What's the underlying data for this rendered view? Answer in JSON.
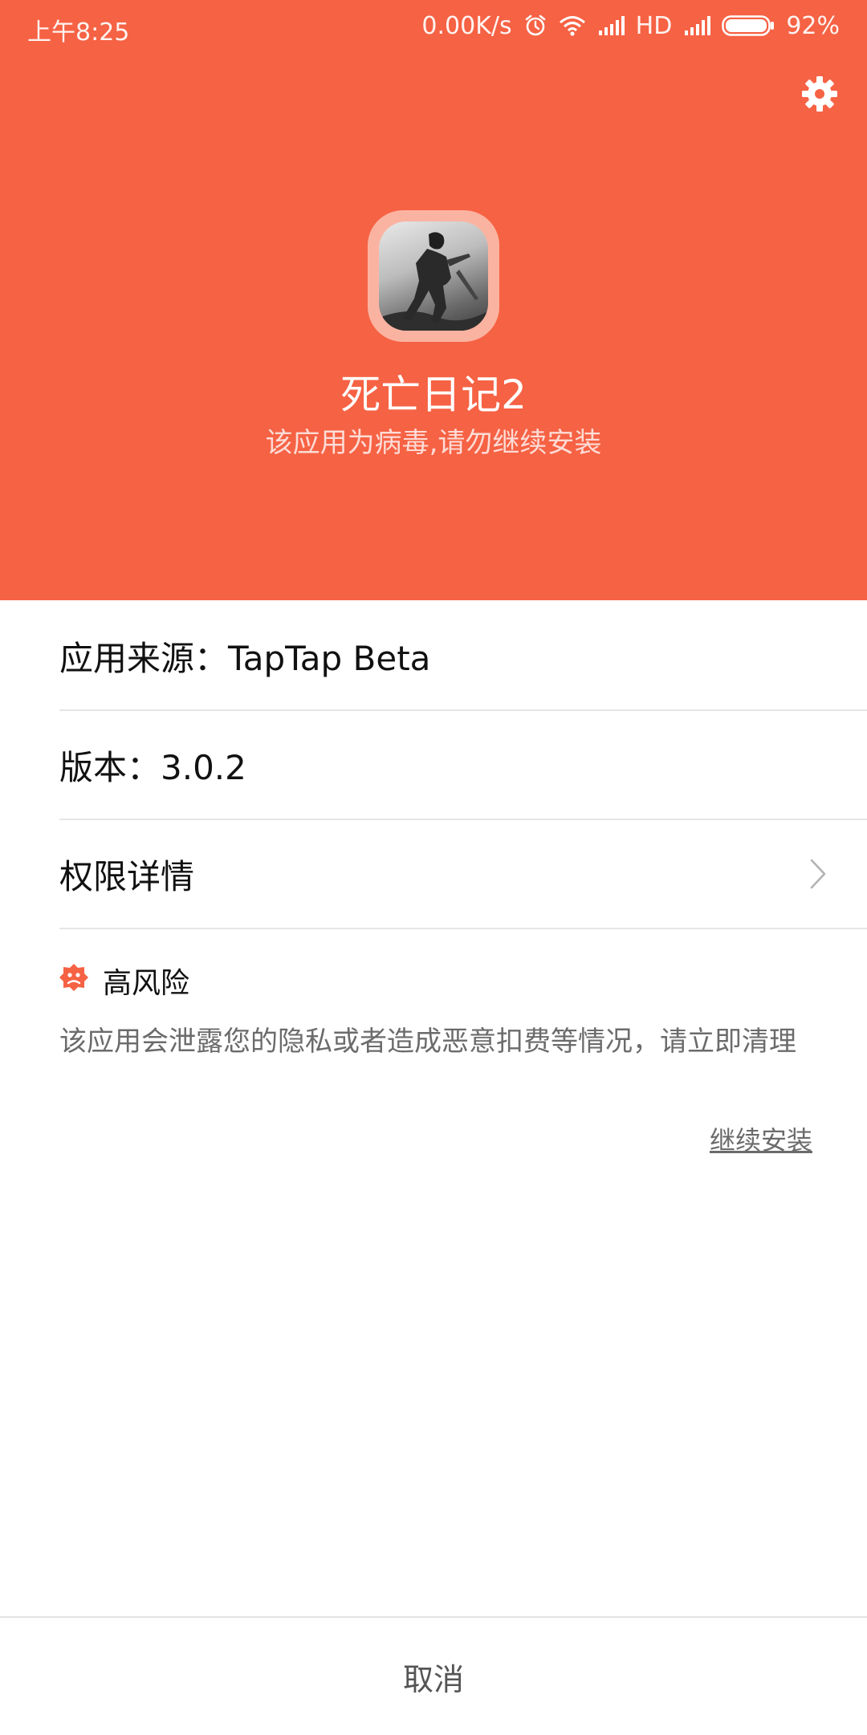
{
  "status_bar": {
    "time": "上午8:25",
    "net_speed": "0.00K/s",
    "hd": "HD",
    "battery": "92%",
    "icons": [
      "alarm-icon",
      "wifi-icon",
      "signal-icon",
      "signal-icon",
      "battery-icon"
    ]
  },
  "header": {
    "bg_color": "#f66244",
    "settings_icon": "gear-icon",
    "app_name": "死亡日记2",
    "warning_subtitle": "该应用为病毒,请勿继续安装"
  },
  "info": {
    "source": "应用来源：TapTap Beta",
    "version": "版本：3.0.2",
    "permissions": "权限详情"
  },
  "risk": {
    "icon": "risk-icon",
    "title": "高风险",
    "description": "该应用会泄露您的隐私或者造成恶意扣费等情况，请立即清理",
    "continue_label": "继续安装"
  },
  "footer": {
    "cancel_label": "取消"
  }
}
